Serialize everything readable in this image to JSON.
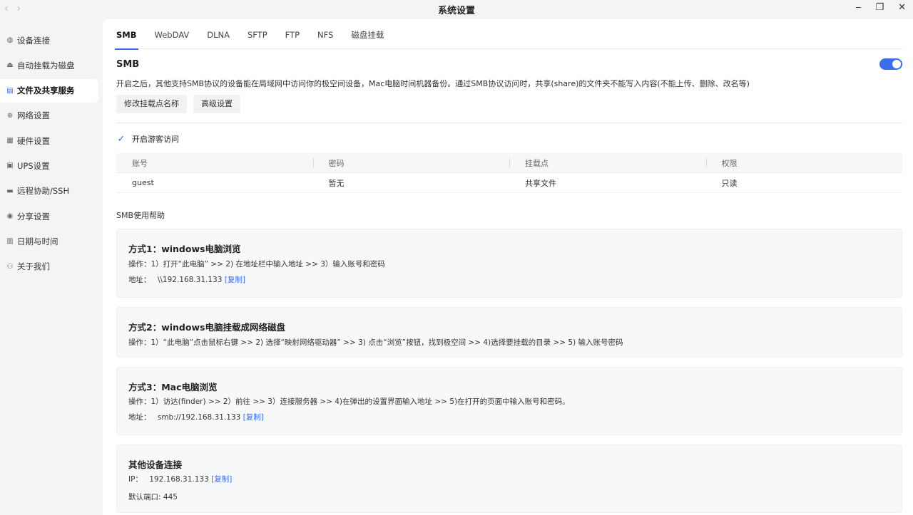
{
  "window": {
    "title": "系统设置",
    "back_icon": "‹",
    "forward_icon": "›",
    "minimize_icon": "‒",
    "restore_icon": "❐",
    "close_icon": "✕"
  },
  "sidebar": {
    "items": [
      {
        "label": "设备连接",
        "icon": "◍"
      },
      {
        "label": "自动挂载为磁盘",
        "icon": "⏏"
      },
      {
        "label": "文件及共享服务",
        "icon": "▤"
      },
      {
        "label": "网络设置",
        "icon": "⊕"
      },
      {
        "label": "硬件设置",
        "icon": "▦"
      },
      {
        "label": "UPS设置",
        "icon": "▣"
      },
      {
        "label": "远程协助/SSH",
        "icon": "▬"
      },
      {
        "label": "分享设置",
        "icon": "◉"
      },
      {
        "label": "日期与时间",
        "icon": "▥"
      },
      {
        "label": "关于我们",
        "icon": "⚇"
      }
    ]
  },
  "tabs": [
    "SMB",
    "WebDAV",
    "DLNA",
    "SFTP",
    "FTP",
    "NFS",
    "磁盘挂载"
  ],
  "smb": {
    "title": "SMB",
    "description": "开启之后，其他支持SMB协议的设备能在局域网中访问你的极空间设备，Mac电脑时间机器备份。通过SMB协议访问时，共享(share)的文件夹不能写入内容(不能上传、删除、改名等)",
    "rename_mount_button": "修改挂载点名称",
    "advanced_button": "高级设置",
    "guest_access_label": "开启游客访问",
    "check_mark": "✓"
  },
  "table": {
    "headers": [
      "账号",
      "密码",
      "挂载点",
      "权限"
    ],
    "rows": [
      [
        "guest",
        "暂无",
        "共享文件",
        "只读"
      ]
    ]
  },
  "help": {
    "title": "SMB使用帮助",
    "copy_label": "[复制]",
    "method1": {
      "title": "方式1：windows电脑浏览",
      "steps": "操作：1）打开“此电脑” >> 2) 在地址栏中输入地址 >> 3）输入账号和密码",
      "address_label": "地址：",
      "address": "\\\\192.168.31.133"
    },
    "method2": {
      "title": "方式2：windows电脑挂载成网络磁盘",
      "steps": "操作：1）“此电脑”点击鼠标右键 >> 2) 选择“映射网络驱动器” >> 3) 点击“浏览”按钮，找到极空间 >> 4)选择要挂载的目录 >> 5) 输入账号密码"
    },
    "method3": {
      "title": "方式3：Mac电脑浏览",
      "steps": "操作：1）访达(finder) >> 2）前往 >> 3）连接服务器 >> 4)在弹出的设置界面输入地址 >> 5)在打开的页面中输入账号和密码。",
      "address_label": "地址：",
      "address": "smb://192.168.31.133"
    },
    "other": {
      "title": "其他设备连接",
      "ip_label": "IP：",
      "ip": "192.168.31.133",
      "port_label": "默认端口:",
      "port": "445"
    }
  },
  "colors": {
    "accent": "#3a6df0",
    "sidebar_bg": "#f3f4f6",
    "card_bg": "#f7f8fa"
  }
}
